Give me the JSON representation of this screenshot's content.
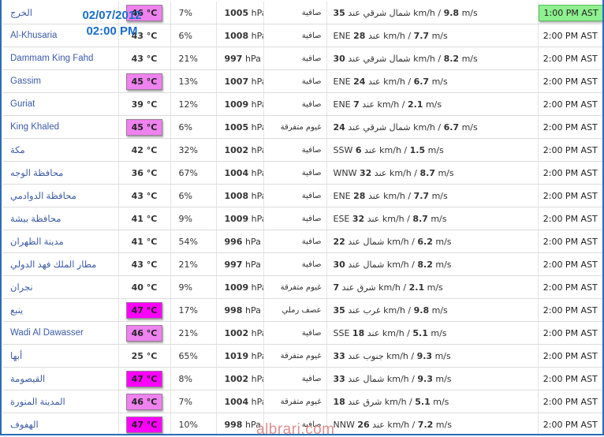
{
  "overlay": {
    "date": "02/07/2012",
    "time": "02:00 PM"
  },
  "watermark": "albrari.com",
  "colors": {
    "hot": "#ee82ee",
    "very_hot": "#ff00ff",
    "highlight_time": "#8ef08e",
    "station_link": "#3b5aa8",
    "frame": "#2a6db5"
  },
  "rows": [
    {
      "station": "الخرج",
      "temp": "46 °C",
      "temp_level": "hot",
      "humidity": "7%",
      "pressure_value": "1005",
      "pressure_unit": "hPa",
      "condition": "صافية",
      "wind_speed": "35",
      "wind_dir": "شمال شرقي عند",
      "wind_kmh_unit": "km/h /",
      "wind_ms": "9.8",
      "wind_ms_unit": "m/s",
      "time": "1:00 PM AST",
      "time_highlight": true
    },
    {
      "station": "Al-Khusaria",
      "temp": "43 °C",
      "temp_level": "normal",
      "humidity": "6%",
      "pressure_value": "1008",
      "pressure_unit": "hPa",
      "condition": "صافية",
      "wind_dir": "ENE",
      "wind_speed": "28",
      "wind_mid": "عند",
      "wind_kmh_unit": "km/h /",
      "wind_ms": "7.7",
      "wind_ms_unit": "m/s",
      "time": "2:00 PM AST",
      "time_highlight": false
    },
    {
      "station": "Dammam King Fahd",
      "temp": "43 °C",
      "temp_level": "normal",
      "humidity": "21%",
      "pressure_value": "997",
      "pressure_unit": "hPa",
      "condition": "صافية",
      "wind_speed": "30",
      "wind_dir": "شمال شرقي عند",
      "wind_kmh_unit": "km/h /",
      "wind_ms": "8.2",
      "wind_ms_unit": "m/s",
      "time": "2:00 PM AST",
      "time_highlight": false
    },
    {
      "station": "Gassim",
      "temp": "45 °C",
      "temp_level": "hot",
      "humidity": "13%",
      "pressure_value": "1007",
      "pressure_unit": "hPa",
      "condition": "صافية",
      "wind_dir": "ENE",
      "wind_speed": "24",
      "wind_mid": "عند",
      "wind_kmh_unit": "km/h /",
      "wind_ms": "6.7",
      "wind_ms_unit": "m/s",
      "time": "2:00 PM AST",
      "time_highlight": false
    },
    {
      "station": "Guriat",
      "temp": "39 °C",
      "temp_level": "normal",
      "humidity": "12%",
      "pressure_value": "1009",
      "pressure_unit": "hPa",
      "condition": "صافية",
      "wind_dir": "ENE",
      "wind_speed": "7",
      "wind_mid": "عند",
      "wind_kmh_unit": "km/h /",
      "wind_ms": "2.1",
      "wind_ms_unit": "m/s",
      "time": "2:00 PM AST",
      "time_highlight": false
    },
    {
      "station": "King Khaled",
      "temp": "45 °C",
      "temp_level": "hot",
      "humidity": "6%",
      "pressure_value": "1005",
      "pressure_unit": "hPa",
      "condition": "غيوم متفرقة",
      "wind_speed": "24",
      "wind_dir": "شمال شرقي عند",
      "wind_kmh_unit": "km/h /",
      "wind_ms": "6.7",
      "wind_ms_unit": "m/s",
      "time": "2:00 PM AST",
      "time_highlight": false
    },
    {
      "station": "مكة",
      "temp": "42 °C",
      "temp_level": "normal",
      "humidity": "32%",
      "pressure_value": "1002",
      "pressure_unit": "hPa",
      "condition": "صافية",
      "wind_dir": "SSW",
      "wind_speed": "6",
      "wind_mid": "عند",
      "wind_kmh_unit": "km/h /",
      "wind_ms": "1.5",
      "wind_ms_unit": "m/s",
      "time": "2:00 PM AST",
      "time_highlight": false
    },
    {
      "station": "محافظة الوجه",
      "temp": "36 °C",
      "temp_level": "normal",
      "humidity": "67%",
      "pressure_value": "1004",
      "pressure_unit": "hPa",
      "condition": "صافية",
      "wind_dir": "WNW",
      "wind_speed": "32",
      "wind_mid": "عند",
      "wind_kmh_unit": "km/h /",
      "wind_ms": "8.7",
      "wind_ms_unit": "m/s",
      "time": "2:00 PM AST",
      "time_highlight": false
    },
    {
      "station": "محافظة الدوادمي",
      "temp": "43 °C",
      "temp_level": "normal",
      "humidity": "6%",
      "pressure_value": "1008",
      "pressure_unit": "hPa",
      "condition": "صافية",
      "wind_dir": "ENE",
      "wind_speed": "28",
      "wind_mid": "عند",
      "wind_kmh_unit": "km/h /",
      "wind_ms": "7.7",
      "wind_ms_unit": "m/s",
      "time": "2:00 PM AST",
      "time_highlight": false
    },
    {
      "station": "محافظة بيشة",
      "temp": "41 °C",
      "temp_level": "normal",
      "humidity": "9%",
      "pressure_value": "1009",
      "pressure_unit": "hPa",
      "condition": "صافية",
      "wind_dir": "ESE",
      "wind_speed": "32",
      "wind_mid": "عند",
      "wind_kmh_unit": "km/h /",
      "wind_ms": "8.7",
      "wind_ms_unit": "m/s",
      "time": "2:00 PM AST",
      "time_highlight": false
    },
    {
      "station": "مدينة الظهران",
      "temp": "41 °C",
      "temp_level": "normal",
      "humidity": "54%",
      "pressure_value": "996",
      "pressure_unit": "hPa",
      "condition": "صافية",
      "wind_speed": "22",
      "wind_dir": "شمال عند",
      "wind_kmh_unit": "km/h /",
      "wind_ms": "6.2",
      "wind_ms_unit": "m/s",
      "time": "2:00 PM AST",
      "time_highlight": false
    },
    {
      "station": "مطار الملك فهد الدولي",
      "temp": "43 °C",
      "temp_level": "normal",
      "humidity": "21%",
      "pressure_value": "997",
      "pressure_unit": "hPa",
      "condition": "صافية",
      "wind_speed": "30",
      "wind_dir": "شمال عند",
      "wind_kmh_unit": "km/h /",
      "wind_ms": "8.2",
      "wind_ms_unit": "m/s",
      "time": "2:00 PM AST",
      "time_highlight": false
    },
    {
      "station": "نجران",
      "temp": "40 °C",
      "temp_level": "normal",
      "humidity": "9%",
      "pressure_value": "1009",
      "pressure_unit": "hPa",
      "condition": "غيوم متفرقة",
      "wind_speed": "7",
      "wind_dir": "شرق عند",
      "wind_kmh_unit": "km/h /",
      "wind_ms": "2.1",
      "wind_ms_unit": "m/s",
      "time": "2:00 PM AST",
      "time_highlight": false
    },
    {
      "station": "ينبع",
      "temp": "47 °C",
      "temp_level": "very_hot",
      "humidity": "17%",
      "pressure_value": "998",
      "pressure_unit": "hPa",
      "condition": "عصف رملي",
      "wind_speed": "35",
      "wind_dir": "غرب عند",
      "wind_kmh_unit": "km/h /",
      "wind_ms": "9.8",
      "wind_ms_unit": "m/s",
      "time": "2:00 PM AST",
      "time_highlight": false
    },
    {
      "station": "Wadi Al Dawasser",
      "temp": "46 °C",
      "temp_level": "hot",
      "humidity": "21%",
      "pressure_value": "1002",
      "pressure_unit": "hPa",
      "condition": "صافية",
      "wind_dir": "SSE",
      "wind_speed": "18",
      "wind_mid": "عند",
      "wind_kmh_unit": "km/h /",
      "wind_ms": "5.1",
      "wind_ms_unit": "m/s",
      "time": "2:00 PM AST",
      "time_highlight": false
    },
    {
      "station": "أبها",
      "temp": "25 °C",
      "temp_level": "normal",
      "humidity": "65%",
      "pressure_value": "1019",
      "pressure_unit": "hPa",
      "condition": "غيوم متفرقة",
      "wind_speed": "33",
      "wind_dir": "جنوب عند",
      "wind_kmh_unit": "km/h /",
      "wind_ms": "9.3",
      "wind_ms_unit": "m/s",
      "time": "2:00 PM AST",
      "time_highlight": false
    },
    {
      "station": "القيصومة",
      "temp": "47 °C",
      "temp_level": "very_hot",
      "humidity": "8%",
      "pressure_value": "1002",
      "pressure_unit": "hPa",
      "condition": "صافية",
      "wind_speed": "33",
      "wind_dir": "شمال عند",
      "wind_kmh_unit": "km/h /",
      "wind_ms": "9.3",
      "wind_ms_unit": "m/s",
      "time": "2:00 PM AST",
      "time_highlight": false
    },
    {
      "station": "المدينة المنورة",
      "temp": "46 °C",
      "temp_level": "hot",
      "humidity": "7%",
      "pressure_value": "1004",
      "pressure_unit": "hPa",
      "condition": "غيوم متفرقة",
      "wind_speed": "18",
      "wind_dir": "شرق عند",
      "wind_kmh_unit": "km/h /",
      "wind_ms": "5.1",
      "wind_ms_unit": "m/s",
      "time": "2:00 PM AST",
      "time_highlight": false
    },
    {
      "station": "الهفوف",
      "temp": "47 °C",
      "temp_level": "very_hot",
      "humidity": "10%",
      "pressure_value": "998",
      "pressure_unit": "hPa",
      "condition": "صافية",
      "wind_dir": "NNW",
      "wind_speed": "26",
      "wind_mid": "عند",
      "wind_kmh_unit": "km/h /",
      "wind_ms": "7.2",
      "wind_ms_unit": "m/s",
      "time": "2:00 PM AST",
      "time_highlight": false
    }
  ]
}
